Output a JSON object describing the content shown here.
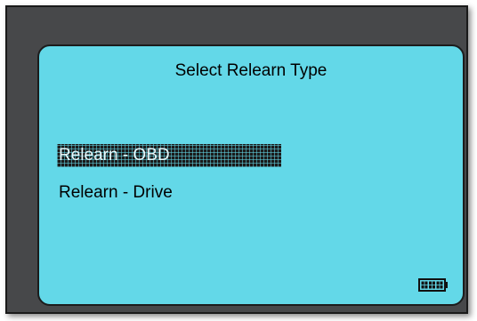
{
  "screen": {
    "title": "Select Relearn Type",
    "menu": [
      {
        "label": "Relearn - OBD",
        "selected": true
      },
      {
        "label": "Relearn - Drive",
        "selected": false
      }
    ]
  },
  "status": {
    "battery_icon": "battery-full-icon",
    "battery_level": 1.0
  },
  "colors": {
    "screen_bg": "#63d8e8",
    "device_bezel": "#47484a",
    "selection_bg": "#1a1a1a"
  }
}
